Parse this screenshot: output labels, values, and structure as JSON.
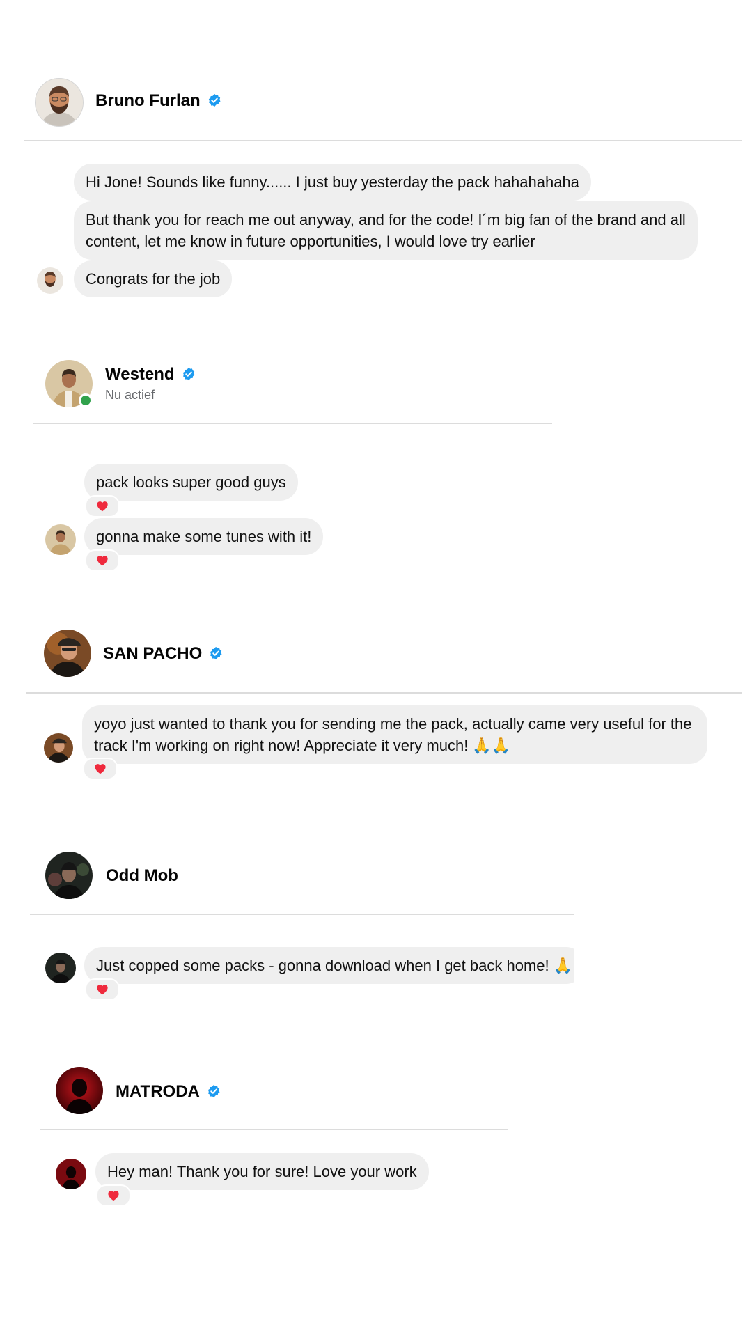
{
  "colors": {
    "verified_badge": "#1d9bf0",
    "bubble_bg": "#efefef",
    "heart": "#ef2a3d",
    "online_dot": "#31a24c"
  },
  "conversations": [
    {
      "name": "Bruno Furlan",
      "verified": true,
      "messages": [
        {
          "text": "Hi Jone! Sounds like funny...... I just buy yesterday the pack hahahahaha"
        },
        {
          "text": "But thank you for reach me out anyway, and for the code! I´m big fan of the brand and all content, let me know in future opportunities, I would love try earlier"
        },
        {
          "text": "Congrats for the job"
        }
      ]
    },
    {
      "name": "Westend",
      "verified": true,
      "status": "Nu actief",
      "messages": [
        {
          "text": "pack looks super good guys",
          "reaction": "heart-icon"
        },
        {
          "text": "gonna make some tunes with it!",
          "reaction": "heart-icon"
        }
      ]
    },
    {
      "name": "SAN PACHO",
      "verified": true,
      "messages": [
        {
          "text": "yoyo just wanted to thank you for sending me the pack, actually came very useful for the track I'm working on right now! Appreciate it very much! 🙏🙏",
          "reaction": "heart-icon"
        }
      ]
    },
    {
      "name": "Odd Mob",
      "verified": false,
      "messages": [
        {
          "text": "Just copped some packs - gonna download when I get back home! 🙏",
          "reaction": "heart-icon"
        }
      ]
    },
    {
      "name": "MATRODA",
      "verified": true,
      "messages": [
        {
          "text": "Hey man! Thank you for sure! Love your work",
          "reaction": "heart-icon"
        }
      ]
    }
  ]
}
